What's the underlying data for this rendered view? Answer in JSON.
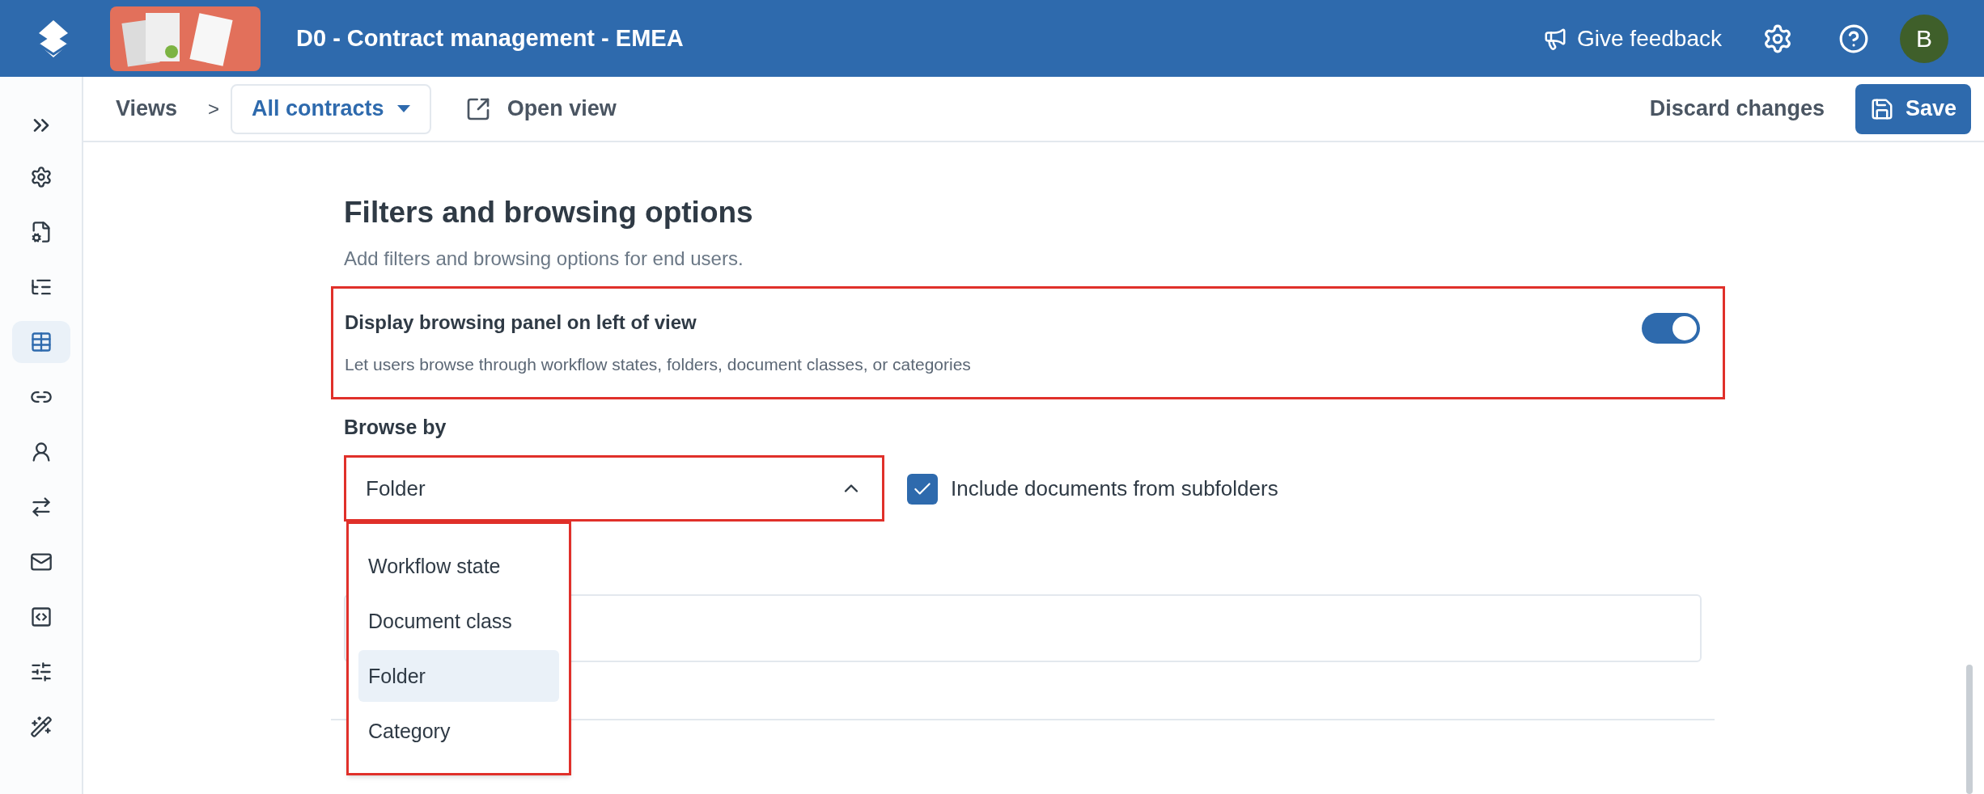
{
  "header": {
    "title": "D0 - Contract management - EMEA",
    "feedback": "Give feedback",
    "avatar": "B"
  },
  "sidebar": {
    "items": [
      {
        "selected": false
      },
      {
        "selected": false
      },
      {
        "selected": false
      },
      {
        "selected": true
      },
      {
        "selected": false
      },
      {
        "selected": false
      },
      {
        "selected": false
      },
      {
        "selected": false
      },
      {
        "selected": false
      },
      {
        "selected": false
      },
      {
        "selected": false
      }
    ]
  },
  "toolbar": {
    "breadcrumb": "Views",
    "separator": ">",
    "view_select": "All contracts",
    "open_view": "Open view",
    "discard": "Discard changes",
    "save": "Save"
  },
  "section": {
    "title": "Filters and browsing options",
    "subtitle": "Add filters and browsing options for end users.",
    "toggle_row": {
      "label": "Display browsing panel on left of view",
      "description": "Let users browse through workflow states, folders, document classes, or categories",
      "on": true,
      "highlighted": true
    },
    "browse_by": "Browse by",
    "select": {
      "value": "Folder",
      "expanded": true,
      "highlighted": true
    },
    "options": [
      {
        "label": "Workflow state",
        "selected": false
      },
      {
        "label": "Document class",
        "selected": false
      },
      {
        "label": "Folder",
        "selected": true
      },
      {
        "label": "Category",
        "selected": false
      }
    ],
    "checkbox": {
      "label": "Include documents from subfolders",
      "checked": true
    }
  }
}
